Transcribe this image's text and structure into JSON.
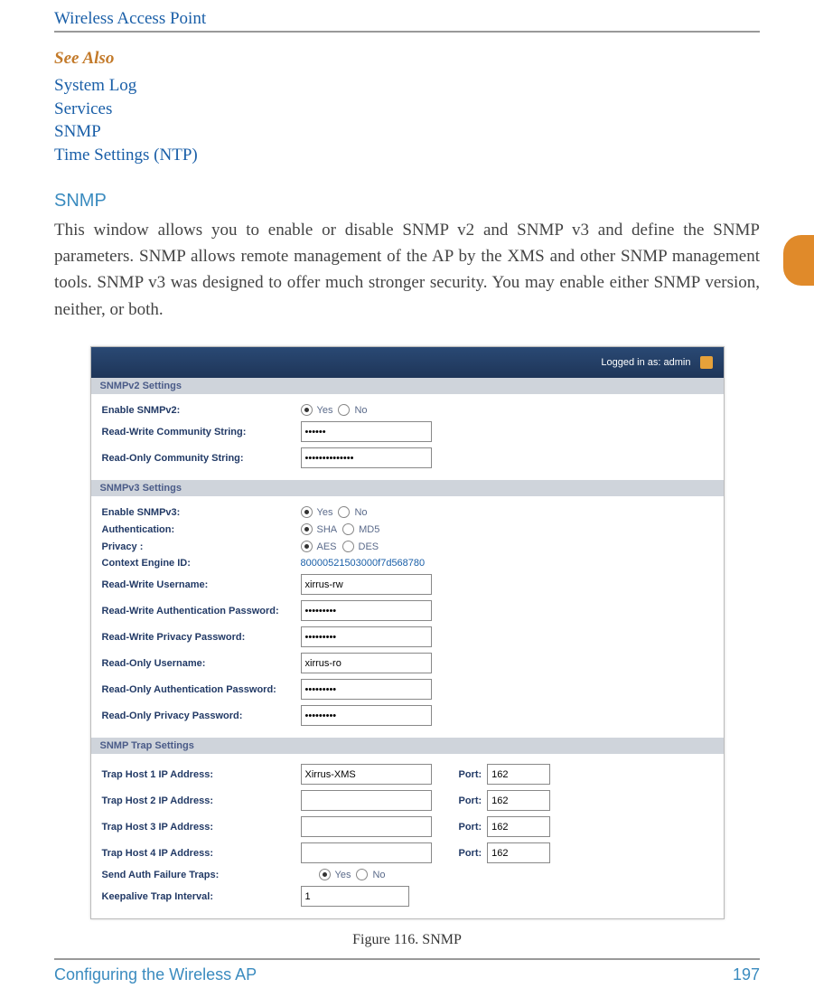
{
  "header": {
    "running_head": "Wireless Access Point"
  },
  "see_also": {
    "title": "See Also",
    "links": [
      "System Log",
      "Services",
      "SNMP",
      "Time Settings (NTP)"
    ]
  },
  "section": {
    "heading": "SNMP",
    "body": "This window allows you to enable or disable SNMP v2 and SNMP v3 and define the SNMP parameters. SNMP allows remote management of the AP by the XMS and other SNMP management tools. SNMP v3 was designed to offer much stronger security. You may enable either SNMP version, neither, or both."
  },
  "figure": {
    "caption": "Figure 116. SNMP",
    "titlebar": {
      "logged_in": "Logged in as: admin"
    },
    "snmpv2": {
      "band": "SNMPv2 Settings",
      "enable_label": "Enable SNMPv2:",
      "enable_opts": [
        "Yes",
        "No"
      ],
      "rw_cs_label": "Read-Write Community String:",
      "rw_cs_value": "••••••",
      "ro_cs_label": "Read-Only Community String:",
      "ro_cs_value": "••••••••••••••"
    },
    "snmpv3": {
      "band": "SNMPv3 Settings",
      "enable_label": "Enable SNMPv3:",
      "enable_opts": [
        "Yes",
        "No"
      ],
      "auth_label": "Authentication:",
      "auth_opts": [
        "SHA",
        "MD5"
      ],
      "priv_label": "Privacy :",
      "priv_opts": [
        "AES",
        "DES"
      ],
      "ctx_label": "Context Engine ID:",
      "ctx_value": "80000521503000f7d568780",
      "rw_user_label": "Read-Write Username:",
      "rw_user_value": "xirrus-rw",
      "rw_auth_pw_label": "Read-Write Authentication Password:",
      "rw_auth_pw_value": "•••••••••",
      "rw_priv_pw_label": "Read-Write Privacy Password:",
      "rw_priv_pw_value": "•••••••••",
      "ro_user_label": "Read-Only Username:",
      "ro_user_value": "xirrus-ro",
      "ro_auth_pw_label": "Read-Only Authentication Password:",
      "ro_auth_pw_value": "•••••••••",
      "ro_priv_pw_label": "Read-Only Privacy Password:",
      "ro_priv_pw_value": "•••••••••"
    },
    "trap": {
      "band": "SNMP Trap Settings",
      "port_label": "Port:",
      "hosts": [
        {
          "label": "Trap Host 1 IP Address:",
          "ip": "Xirrus-XMS",
          "port": "162"
        },
        {
          "label": "Trap Host 2 IP Address:",
          "ip": "",
          "port": "162"
        },
        {
          "label": "Trap Host 3 IP Address:",
          "ip": "",
          "port": "162"
        },
        {
          "label": "Trap Host 4 IP Address:",
          "ip": "",
          "port": "162"
        }
      ],
      "send_fail_label": "Send Auth Failure Traps:",
      "send_fail_opts": [
        "Yes",
        "No"
      ],
      "keepalive_label": "Keepalive Trap Interval:",
      "keepalive_value": "1"
    }
  },
  "footer": {
    "section": "Configuring the Wireless AP",
    "page": "197"
  }
}
